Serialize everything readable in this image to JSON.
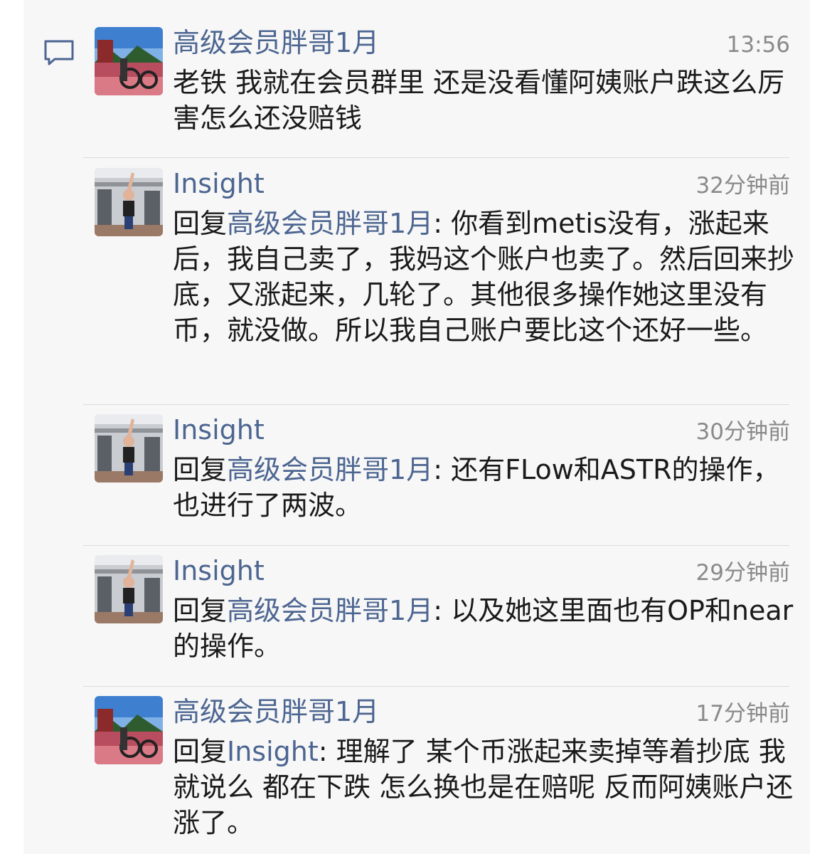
{
  "messages": [
    {
      "author": "高级会员胖哥1月",
      "time": "13:56",
      "reply_prefix": "",
      "reply_target": "",
      "reply_sep": "",
      "text": "老铁  我就在会员群里  还是没看懂阿姨账户跌这么厉害怎么还没赔钱"
    },
    {
      "author": "Insight",
      "time": "32分钟前",
      "reply_prefix": "回复",
      "reply_target": "高级会员胖哥1月",
      "reply_sep": ": ",
      "text": "你看到metis没有，涨起来后，我自己卖了，我妈这个账户也卖了。然后回来抄底，又涨起来，几轮了。其他很多操作她这里没有币，就没做。所以我自己账户要比这个还好一些。"
    },
    {
      "author": "Insight",
      "time": "30分钟前",
      "reply_prefix": "回复",
      "reply_target": "高级会员胖哥1月",
      "reply_sep": ": ",
      "text": "还有FLow和ASTR的操作，也进行了两波。"
    },
    {
      "author": "Insight",
      "time": "29分钟前",
      "reply_prefix": "回复",
      "reply_target": "高级会员胖哥1月",
      "reply_sep": ": ",
      "text": "以及她这里面也有OP和near的操作。"
    },
    {
      "author": "高级会员胖哥1月",
      "time": "17分钟前",
      "reply_prefix": "回复",
      "reply_target": "Insight",
      "reply_sep": ": ",
      "text": "理解了  某个币涨起来卖掉等着抄底  我就说么  都在下跌  怎么换也是在赔呢  反而阿姨账户还涨了。"
    }
  ],
  "colors": {
    "name": "#4d6691",
    "time": "#8a8a8a",
    "text": "#1a1a1a",
    "panel": "#f7f7f7",
    "separator": "#dcdcdc"
  },
  "icons": {
    "comment": "comment-bubble-icon"
  }
}
